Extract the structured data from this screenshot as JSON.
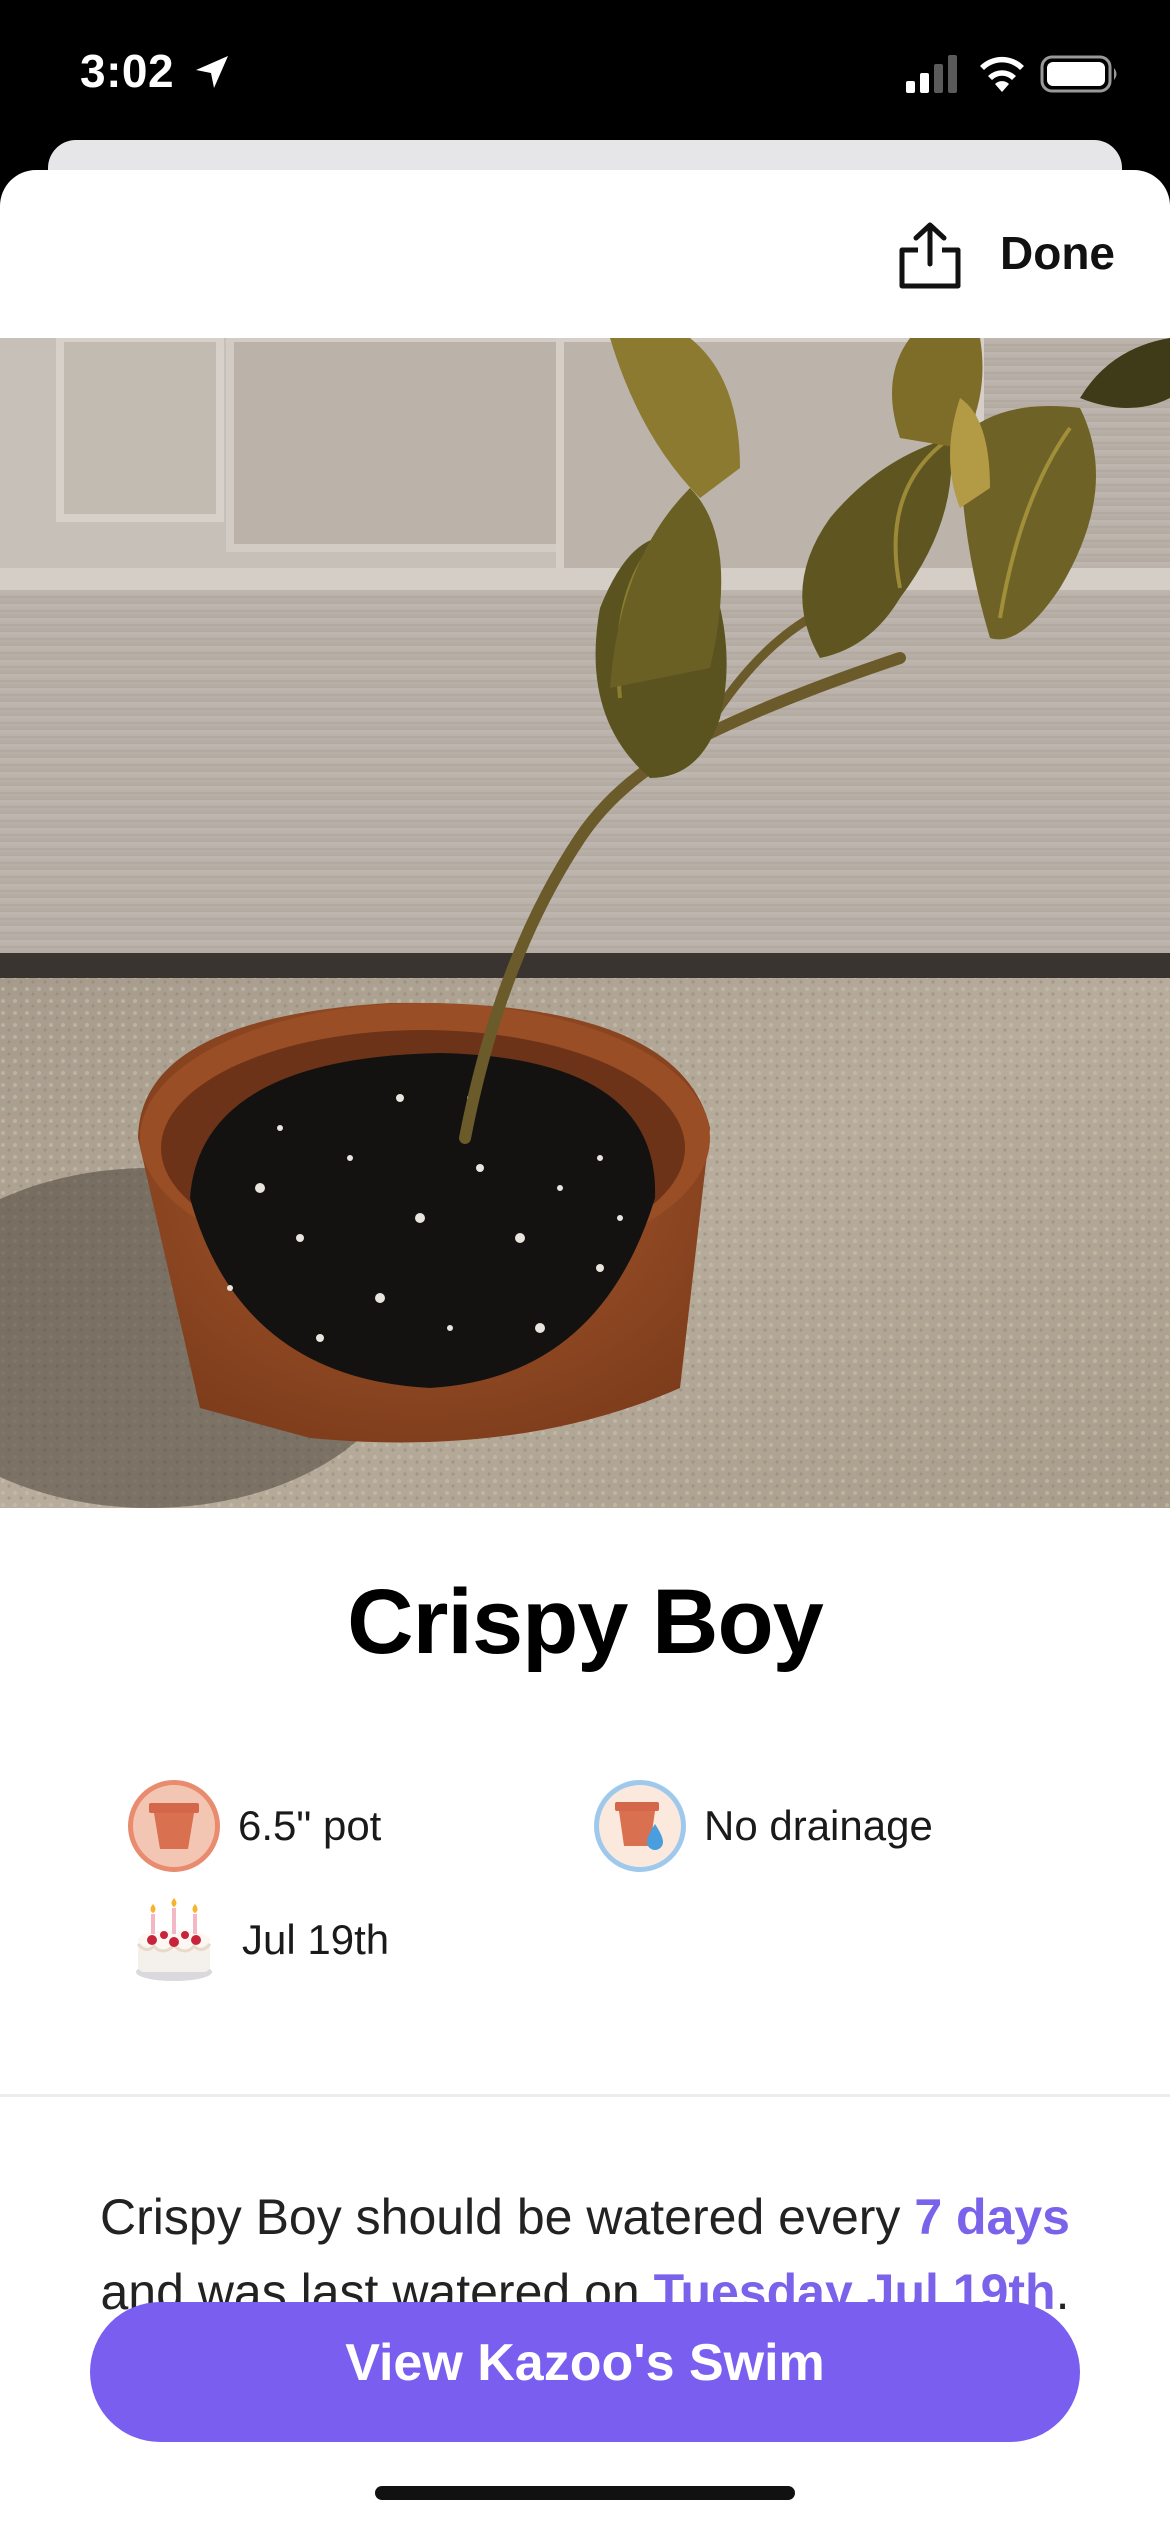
{
  "status": {
    "time": "3:02"
  },
  "nav": {
    "done_label": "Done",
    "share_icon": "share-icon"
  },
  "plant": {
    "name": "Crispy Boy",
    "pot_size": "6.5\" pot",
    "drainage": "No drainage",
    "birthday": "Jul 19th"
  },
  "watering": {
    "prefix": "Crispy Boy should be watered every ",
    "interval": "7 days",
    "middle": " and was last watered on ",
    "last_watered": "Tuesday Jul 19th",
    "suffix": "."
  },
  "cta": {
    "label": "View Kazoo's Swim"
  },
  "colors": {
    "accent": "#7a5ef0",
    "highlight_text": "#7a62ea"
  }
}
